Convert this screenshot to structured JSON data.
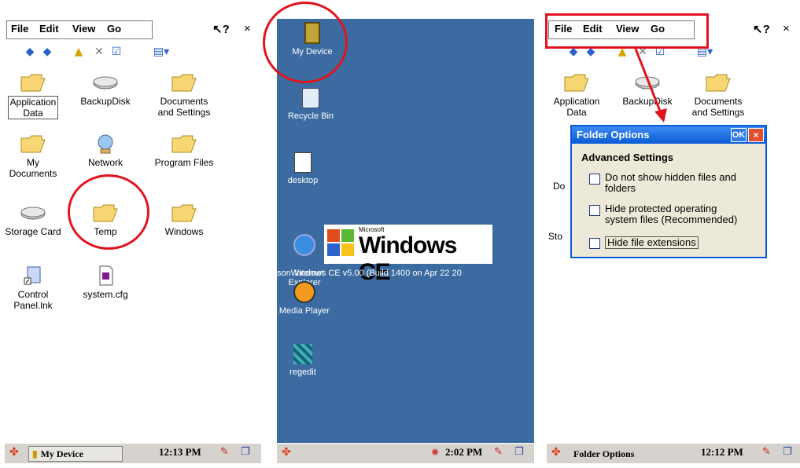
{
  "explorer1": {
    "menu": [
      "File",
      "Edit",
      "View",
      "Go"
    ],
    "help": "?",
    "close": "×",
    "items": [
      {
        "label": "Application\nData",
        "icon": "folder-icon"
      },
      {
        "label": "BackupDisk",
        "icon": "drive-icon"
      },
      {
        "label": "Documents\nand Settings",
        "icon": "folder-icon"
      },
      {
        "label": "My\nDocuments",
        "icon": "folder-icon"
      },
      {
        "label": "Network",
        "icon": "network-icon"
      },
      {
        "label": "Program Files",
        "icon": "folder-icon"
      },
      {
        "label": "Storage Card",
        "icon": "drive-icon"
      },
      {
        "label": "Temp",
        "icon": "folder-icon"
      },
      {
        "label": "Windows",
        "icon": "folder-icon"
      },
      {
        "label": "Control\nPanel.lnk",
        "icon": "shortcut-icon"
      },
      {
        "label": "system.cfg",
        "icon": "file-icon"
      }
    ],
    "taskbar": {
      "task": "My Device",
      "time": "12:13 PM"
    }
  },
  "desktop": {
    "icons": [
      "My Device",
      "Recycle Bin",
      "desktop",
      "Internet\nExplorer",
      "Media Player",
      "regedit"
    ],
    "ce_logo_small": "Microsoft",
    "ce_logo": "Windows CE",
    "build_text": "sonWindows CE v5.00 (Build 1400 on Apr 22 20",
    "time": "2:02 PM"
  },
  "explorer2": {
    "menu": [
      "File",
      "Edit",
      "View",
      "Go"
    ],
    "help": "?",
    "close": "×",
    "items_visible": [
      "Application\nData",
      "BackupDisk",
      "Documents\nand Settings"
    ],
    "side_labels": [
      "Do",
      "Sto"
    ],
    "dialog": {
      "title": "Folder Options",
      "ok": "OK",
      "close": "×",
      "section": "Advanced Settings",
      "options": [
        {
          "label": "Do not show hidden files and\nfolders",
          "checked": false
        },
        {
          "label": "Hide protected operating\nsystem files (Recommended)",
          "checked": false
        },
        {
          "label": "Hide file extensions",
          "checked": false
        }
      ]
    },
    "taskbar": {
      "task": "Folder Options",
      "time": "12:12 PM"
    }
  },
  "colors": {
    "highlight": "#e0141e",
    "desktop": "#3b6ba1",
    "taskbar": "#d6d3ce"
  }
}
